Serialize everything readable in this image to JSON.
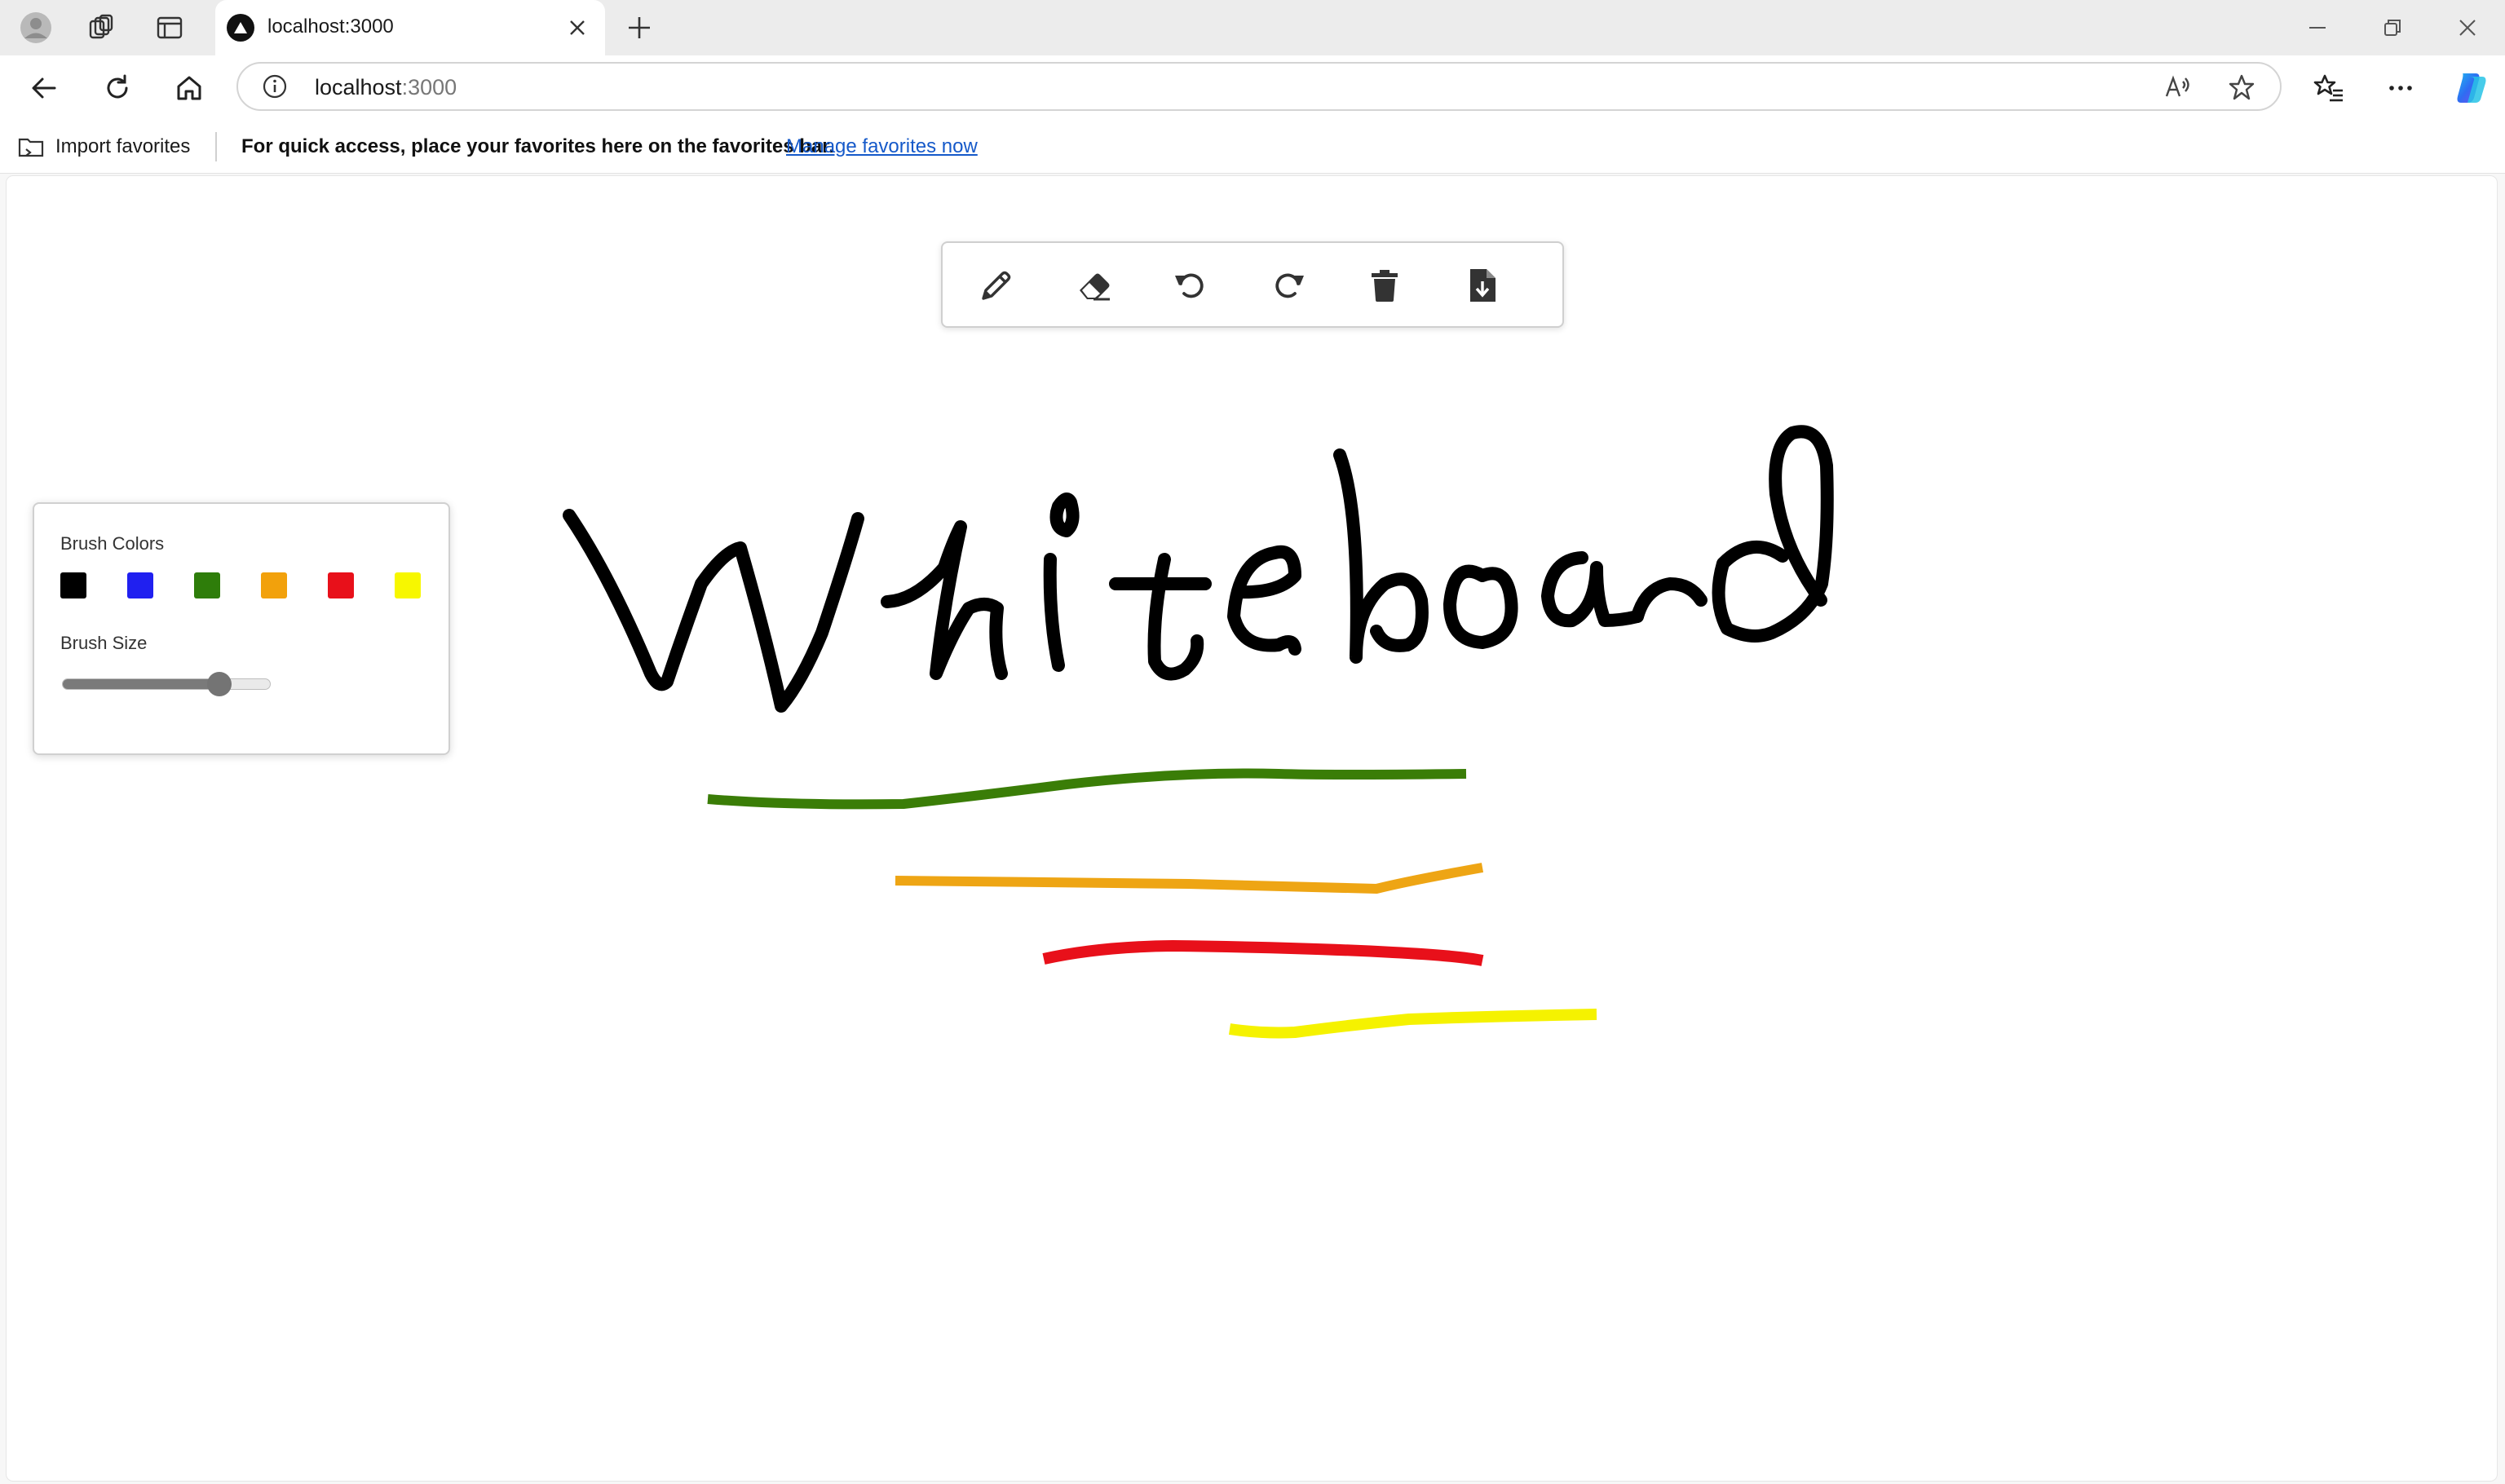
{
  "browser": {
    "tab_title": "localhost:3000",
    "url_host": "localhost",
    "url_port": ":3000",
    "favorites_bar": {
      "import_label": "Import favorites",
      "message": "For quick access, place your favorites here on the favorites bar.",
      "manage_link": "Manage favorites now"
    },
    "icons": [
      "profile-icon",
      "workspaces-icon",
      "tab-actions-icon",
      "close-tab-icon",
      "new-tab-icon",
      "minimize-icon",
      "restore-icon",
      "close-window-icon",
      "back-icon",
      "refresh-icon",
      "home-icon",
      "info-icon",
      "read-aloud-icon",
      "favorite-star-icon",
      "favorites-icon",
      "more-icon",
      "copilot-icon"
    ]
  },
  "toolbar": {
    "tools": [
      {
        "name": "pencil",
        "icon": "pencil-icon"
      },
      {
        "name": "eraser",
        "icon": "eraser-icon"
      },
      {
        "name": "undo",
        "icon": "undo-icon"
      },
      {
        "name": "redo",
        "icon": "redo-icon"
      },
      {
        "name": "clear",
        "icon": "trash-icon"
      },
      {
        "name": "download",
        "icon": "download-file-icon"
      }
    ]
  },
  "settings_panel": {
    "colors_label": "Brush Colors",
    "colors": [
      "#000000",
      "#2020f0",
      "#2e7d0a",
      "#f2a10c",
      "#e8101a",
      "#f7f700"
    ],
    "size_label": "Brush Size",
    "size_fraction": 0.75
  },
  "canvas": {
    "handwritten_word": "Whiteboard",
    "strokes": [
      {
        "color": "#000000",
        "shape": "whiteboard-handwriting"
      },
      {
        "color": "#3a7d07"
      },
      {
        "color": "#eea514"
      },
      {
        "color": "#e8101a"
      },
      {
        "color": "#f5f200"
      }
    ]
  }
}
